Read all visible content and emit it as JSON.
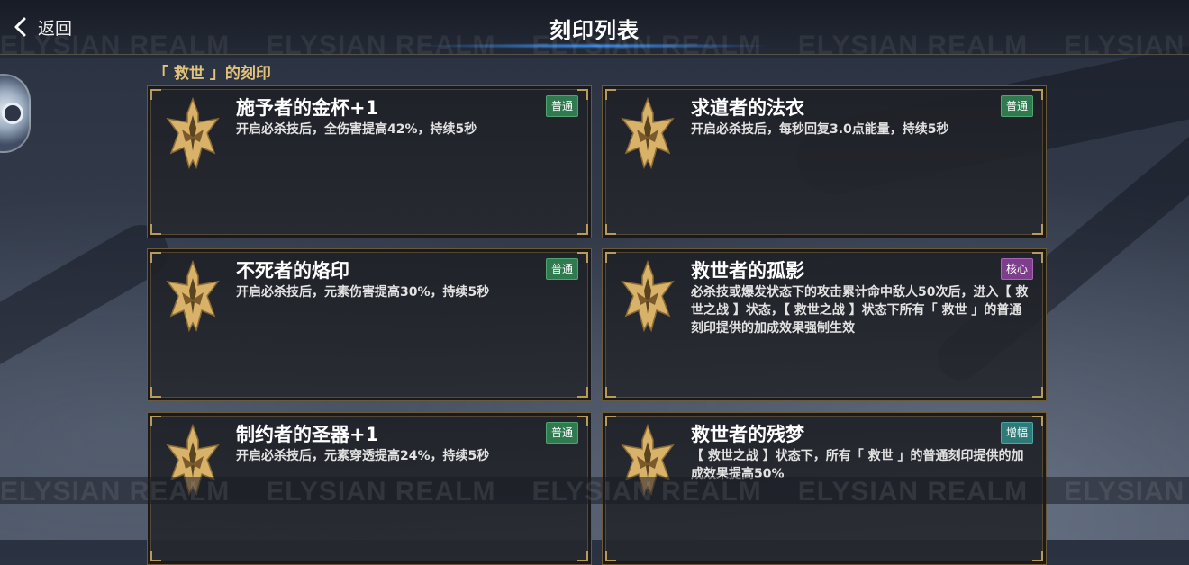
{
  "header": {
    "back_label": "返回",
    "title": "刻印列表"
  },
  "section": {
    "title": "「 救世 」的刻印"
  },
  "watermark": "ELYSIAN REALM",
  "colors": {
    "accent_gold": "#e0c27a",
    "tag_normal": "#2f7a4f",
    "tag_core": "#7d3f8c",
    "tag_amp": "#2d7a78",
    "glow_blue": "#3c96ff"
  },
  "icons": {
    "back": "chevron-left-icon",
    "emblem": "sword-crest-emblem-icon"
  },
  "cards": [
    {
      "title": "施予者的金杯+1",
      "tag": "普通",
      "desc": "开启必杀技后，全伤害提高42%，持续5秒"
    },
    {
      "title": "求道者的法衣",
      "tag": "普通",
      "desc": "开启必杀技后，每秒回复3.0点能量，持续5秒"
    },
    {
      "title": "不死者的烙印",
      "tag": "普通",
      "desc": "开启必杀技后，元素伤害提高30%，持续5秒"
    },
    {
      "title": "救世者的孤影",
      "tag": "核心",
      "desc": "必杀技或爆发状态下的攻击累计命中敌人50次后，进入【 救世之战 】状态，【 救世之战 】状态下所有「 救世 」的普通刻印提供的加成效果强制生效"
    },
    {
      "title": "制约者的圣器+1",
      "tag": "普通",
      "desc": "开启必杀技后，元素穿透提高24%，持续5秒"
    },
    {
      "title": "救世者的残梦",
      "tag": "增幅",
      "desc": "【 救世之战 】状态下，所有「 救世 」的普通刻印提供的加成效果提高50%"
    }
  ]
}
